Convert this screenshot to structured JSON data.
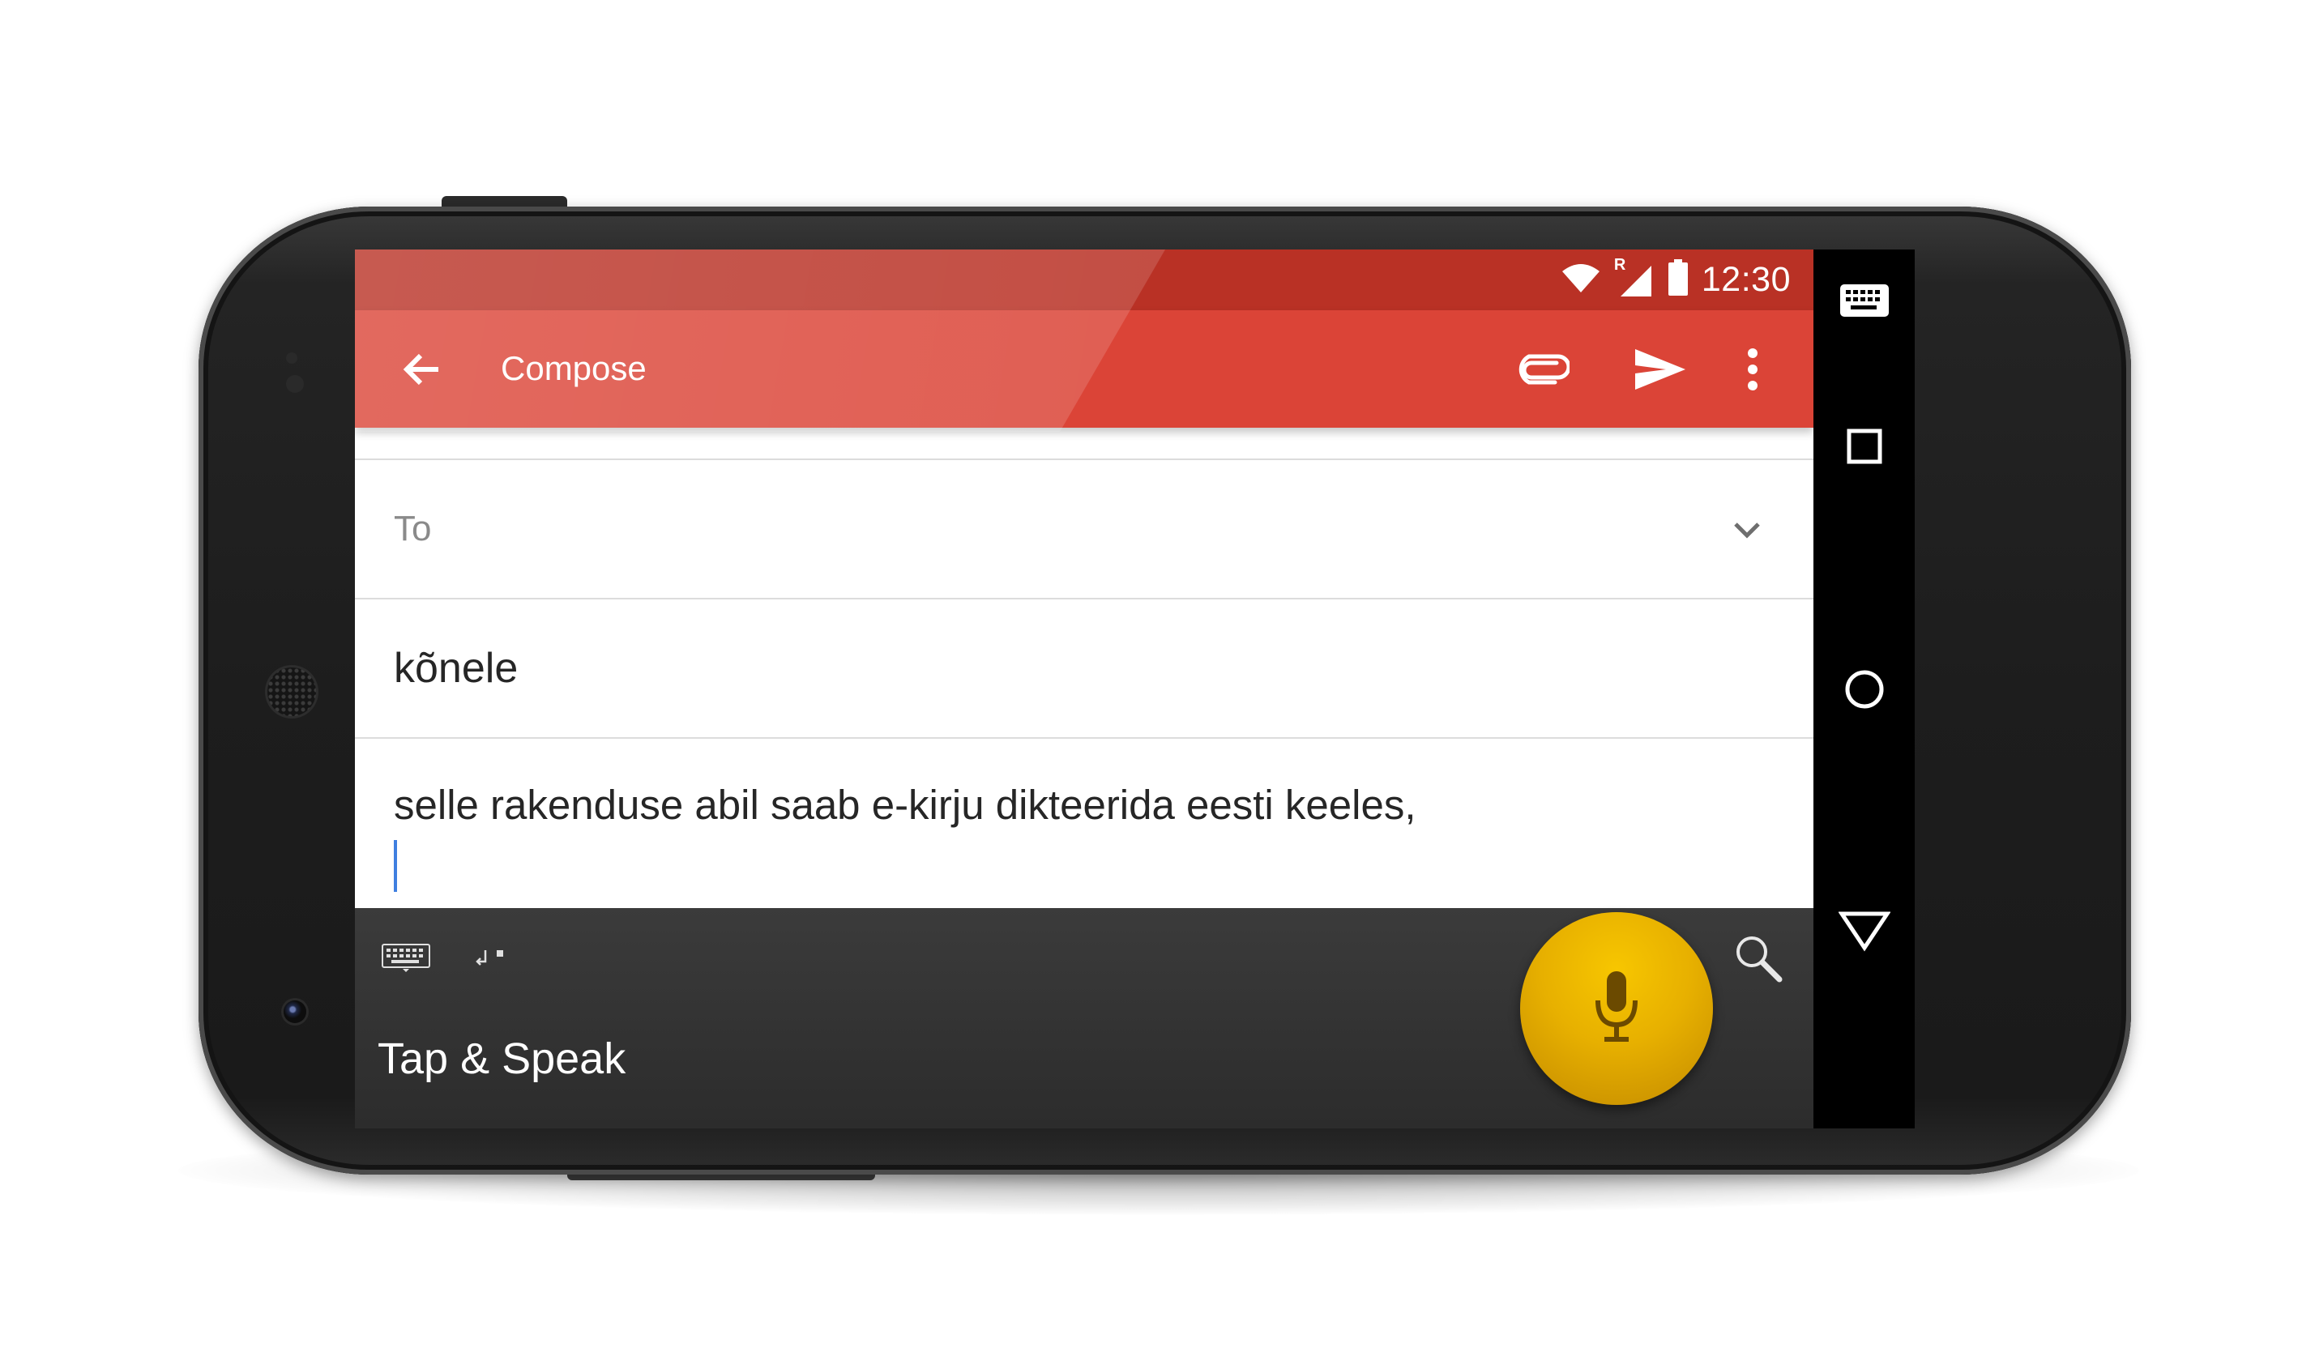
{
  "status_bar": {
    "time": "12:30",
    "roaming_indicator": "R",
    "icons": [
      "wifi-icon",
      "signal-icon",
      "battery-icon"
    ]
  },
  "toolbar": {
    "title": "Compose",
    "back_icon": "arrow-back-icon",
    "actions": [
      "attach-icon",
      "send-icon",
      "more-vert-icon"
    ]
  },
  "compose": {
    "to_label": "To",
    "subject": "kõnele",
    "body": "selle rakenduse abil saab e-kirju dikteerida eesti keeles,"
  },
  "ime": {
    "hint": "Tap & Speak",
    "icons": [
      "keyboard-icon",
      "enter-icon",
      "mic-icon",
      "search-icon"
    ]
  },
  "nav_bar": {
    "icons": [
      "keyboard-switch-icon",
      "recents-icon",
      "home-icon",
      "back-icon"
    ]
  },
  "colors": {
    "status_bar": "#b93125",
    "toolbar": "#db4437",
    "mic_button": "#e7b000",
    "ime_background": "#2c2c2c",
    "caret": "#3f7fe0"
  }
}
